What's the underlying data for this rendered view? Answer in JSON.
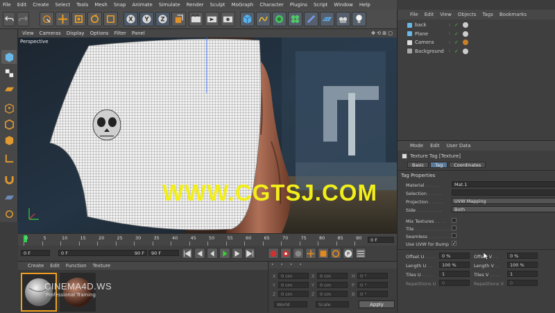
{
  "menubar": [
    "File",
    "Edit",
    "Create",
    "Select",
    "Tools",
    "Mesh",
    "Snap",
    "Animate",
    "Simulate",
    "Render",
    "Sculpt",
    "MoGraph",
    "Character",
    "Plugins",
    "Script",
    "Window",
    "Help"
  ],
  "viewport_menu": [
    "View",
    "Cameras",
    "Display",
    "Options",
    "Filter",
    "Panel"
  ],
  "viewport_label": "Perspective",
  "watermark": "WWW.CGTSJ.COM",
  "object_manager": {
    "menu": [
      "File",
      "Edit",
      "View",
      "Objects",
      "Tags",
      "Bookmarks"
    ],
    "objects": [
      "back",
      "Plane",
      "Camera",
      "Background"
    ]
  },
  "timeline": {
    "ticks": [
      "0",
      "5",
      "10",
      "15",
      "20",
      "25",
      "30",
      "35",
      "40",
      "45",
      "50",
      "55",
      "60",
      "65",
      "70",
      "75",
      "80",
      "85",
      "90"
    ],
    "frame_display": "0 F",
    "start_field": "0 F",
    "current_field": "0 F",
    "end_field": "90 F",
    "max_field": "90 F"
  },
  "material_manager": {
    "menu": [
      "Create",
      "Edit",
      "Function",
      "Texture"
    ],
    "logo_text": "CINEMA4D.WS",
    "logo_sub": "Professional Training"
  },
  "coordinates": {
    "rows": [
      {
        "a_label": "X",
        "a_val": "0 cm",
        "b_label": "X",
        "b_val": "0 cm",
        "c_label": "H",
        "c_val": "0 °"
      },
      {
        "a_label": "Y",
        "a_val": "0 cm",
        "b_label": "Y",
        "b_val": "0 cm",
        "c_label": "P",
        "c_val": "0 °"
      },
      {
        "a_label": "Z",
        "a_val": "0 cm",
        "b_label": "Z",
        "b_val": "0 cm",
        "c_label": "B",
        "c_val": "0 °"
      }
    ],
    "world_select": "World",
    "scale_select": "Scale",
    "apply_label": "Apply"
  },
  "attribute_manager": {
    "menu": [
      "Mode",
      "Edit",
      "User Data"
    ],
    "title": "Texture Tag [Texture]",
    "tabs": [
      "Basic",
      "Tag",
      "Coordinates"
    ],
    "section": "Tag Properties",
    "material_label": "Material",
    "material_value": "Mat.1",
    "selection_label": "Selection",
    "projection_label": "Projection",
    "projection_value": "UVW Mapping",
    "side_label": "Side",
    "side_value": "Both",
    "mix_label": "Mix Textures",
    "tile_label": "Tile",
    "seamless_label": "Seamless",
    "uvw_bump_label": "Use UVW for Bump",
    "offset_u_label": "Offset U",
    "offset_u_value": "0 %",
    "offset_v_label": "Offset V",
    "offset_v_value": "0 %",
    "length_u_label": "Length U",
    "length_u_value": "100 %",
    "length_v_label": "Length V",
    "length_v_value": "100 %",
    "tiles_u_label": "Tiles U",
    "tiles_u_value": "1",
    "tiles_v_label": "Tiles V",
    "tiles_v_value": "1",
    "rep_u_label": "Repetitions U",
    "rep_u_value": "0",
    "rep_v_label": "Repetitions V",
    "rep_v_value": "0"
  }
}
